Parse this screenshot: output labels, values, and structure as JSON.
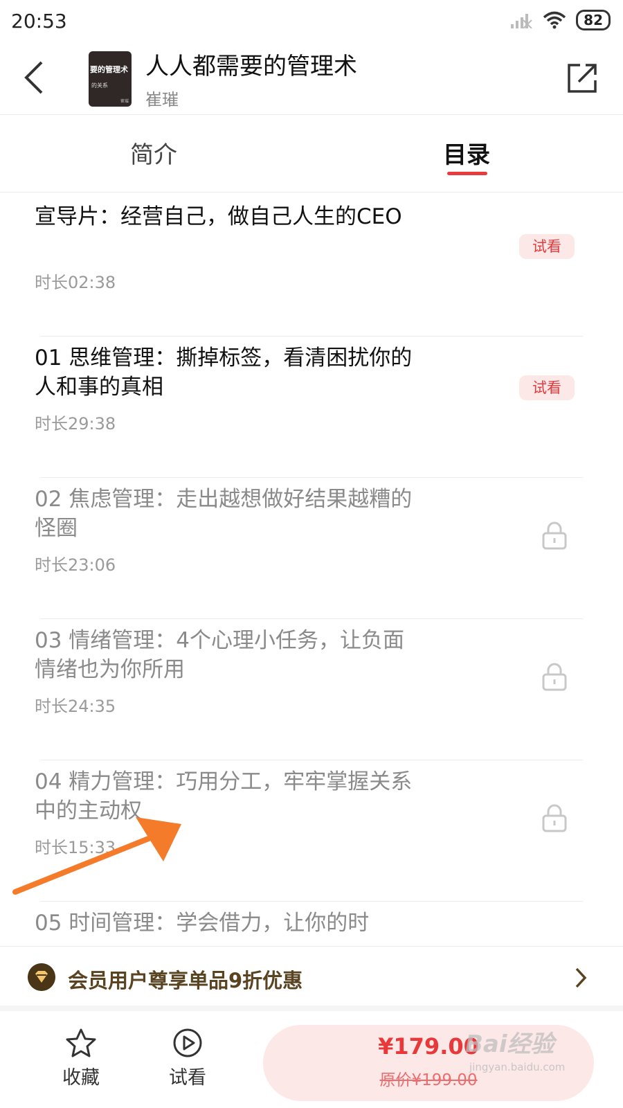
{
  "status": {
    "time": "20:53",
    "battery": "82"
  },
  "header": {
    "title": "人人都需要的管理术",
    "author": "崔璀",
    "cover": {
      "title_text": "要的管理术",
      "sub_text": "的关系",
      "mark_text": "崔璀"
    }
  },
  "tabs": [
    {
      "label": "简介",
      "active": false
    },
    {
      "label": "目录",
      "active": true
    }
  ],
  "catalog": [
    {
      "title": "宣导片：经营自己，做自己人生的CEO",
      "duration": "时长02:38",
      "status": "trial",
      "badge": "试看"
    },
    {
      "title": "01 思维管理：撕掉标签，看清困扰你的人和事的真相",
      "duration": "时长29:38",
      "status": "trial",
      "badge": "试看"
    },
    {
      "title": "02 焦虑管理：走出越想做好结果越糟的怪圈",
      "duration": "时长23:06",
      "status": "locked",
      "badge": ""
    },
    {
      "title": "03 情绪管理：4个心理小任务，让负面情绪也为你所用",
      "duration": "时长24:35",
      "status": "locked",
      "badge": ""
    },
    {
      "title": "04 精力管理：巧用分工，牢牢掌握关系中的主动权",
      "duration": "时长15:33",
      "status": "locked",
      "badge": ""
    },
    {
      "title": "05 时间管理：学会借力，让你的时",
      "duration": "",
      "status": "locked",
      "badge": ""
    }
  ],
  "promo": {
    "text": "会员用户尊享单品9折优惠"
  },
  "bottom": {
    "favorite_label": "收藏",
    "trial_label": "试看",
    "price": "¥179.00",
    "original_price": "原价¥199.00"
  },
  "watermark": {
    "main": "Bai经验",
    "sub": "jingyan.baidu.com"
  },
  "colors": {
    "accent": "#e93b3d",
    "badge_bg": "#fde8e8",
    "promo_text": "#5a4320",
    "arrow": "#f47b2a"
  }
}
